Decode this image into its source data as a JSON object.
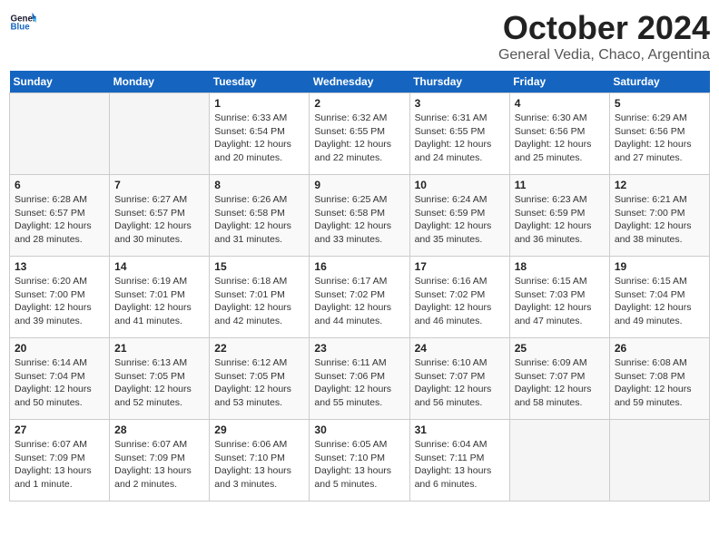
{
  "logo": {
    "line1": "General",
    "line2": "Blue"
  },
  "title": "October 2024",
  "subtitle": "General Vedia, Chaco, Argentina",
  "days_of_week": [
    "Sunday",
    "Monday",
    "Tuesday",
    "Wednesday",
    "Thursday",
    "Friday",
    "Saturday"
  ],
  "weeks": [
    [
      {
        "day": "",
        "info": ""
      },
      {
        "day": "",
        "info": ""
      },
      {
        "day": "1",
        "info": "Sunrise: 6:33 AM\nSunset: 6:54 PM\nDaylight: 12 hours\nand 20 minutes."
      },
      {
        "day": "2",
        "info": "Sunrise: 6:32 AM\nSunset: 6:55 PM\nDaylight: 12 hours\nand 22 minutes."
      },
      {
        "day": "3",
        "info": "Sunrise: 6:31 AM\nSunset: 6:55 PM\nDaylight: 12 hours\nand 24 minutes."
      },
      {
        "day": "4",
        "info": "Sunrise: 6:30 AM\nSunset: 6:56 PM\nDaylight: 12 hours\nand 25 minutes."
      },
      {
        "day": "5",
        "info": "Sunrise: 6:29 AM\nSunset: 6:56 PM\nDaylight: 12 hours\nand 27 minutes."
      }
    ],
    [
      {
        "day": "6",
        "info": "Sunrise: 6:28 AM\nSunset: 6:57 PM\nDaylight: 12 hours\nand 28 minutes."
      },
      {
        "day": "7",
        "info": "Sunrise: 6:27 AM\nSunset: 6:57 PM\nDaylight: 12 hours\nand 30 minutes."
      },
      {
        "day": "8",
        "info": "Sunrise: 6:26 AM\nSunset: 6:58 PM\nDaylight: 12 hours\nand 31 minutes."
      },
      {
        "day": "9",
        "info": "Sunrise: 6:25 AM\nSunset: 6:58 PM\nDaylight: 12 hours\nand 33 minutes."
      },
      {
        "day": "10",
        "info": "Sunrise: 6:24 AM\nSunset: 6:59 PM\nDaylight: 12 hours\nand 35 minutes."
      },
      {
        "day": "11",
        "info": "Sunrise: 6:23 AM\nSunset: 6:59 PM\nDaylight: 12 hours\nand 36 minutes."
      },
      {
        "day": "12",
        "info": "Sunrise: 6:21 AM\nSunset: 7:00 PM\nDaylight: 12 hours\nand 38 minutes."
      }
    ],
    [
      {
        "day": "13",
        "info": "Sunrise: 6:20 AM\nSunset: 7:00 PM\nDaylight: 12 hours\nand 39 minutes."
      },
      {
        "day": "14",
        "info": "Sunrise: 6:19 AM\nSunset: 7:01 PM\nDaylight: 12 hours\nand 41 minutes."
      },
      {
        "day": "15",
        "info": "Sunrise: 6:18 AM\nSunset: 7:01 PM\nDaylight: 12 hours\nand 42 minutes."
      },
      {
        "day": "16",
        "info": "Sunrise: 6:17 AM\nSunset: 7:02 PM\nDaylight: 12 hours\nand 44 minutes."
      },
      {
        "day": "17",
        "info": "Sunrise: 6:16 AM\nSunset: 7:02 PM\nDaylight: 12 hours\nand 46 minutes."
      },
      {
        "day": "18",
        "info": "Sunrise: 6:15 AM\nSunset: 7:03 PM\nDaylight: 12 hours\nand 47 minutes."
      },
      {
        "day": "19",
        "info": "Sunrise: 6:15 AM\nSunset: 7:04 PM\nDaylight: 12 hours\nand 49 minutes."
      }
    ],
    [
      {
        "day": "20",
        "info": "Sunrise: 6:14 AM\nSunset: 7:04 PM\nDaylight: 12 hours\nand 50 minutes."
      },
      {
        "day": "21",
        "info": "Sunrise: 6:13 AM\nSunset: 7:05 PM\nDaylight: 12 hours\nand 52 minutes."
      },
      {
        "day": "22",
        "info": "Sunrise: 6:12 AM\nSunset: 7:05 PM\nDaylight: 12 hours\nand 53 minutes."
      },
      {
        "day": "23",
        "info": "Sunrise: 6:11 AM\nSunset: 7:06 PM\nDaylight: 12 hours\nand 55 minutes."
      },
      {
        "day": "24",
        "info": "Sunrise: 6:10 AM\nSunset: 7:07 PM\nDaylight: 12 hours\nand 56 minutes."
      },
      {
        "day": "25",
        "info": "Sunrise: 6:09 AM\nSunset: 7:07 PM\nDaylight: 12 hours\nand 58 minutes."
      },
      {
        "day": "26",
        "info": "Sunrise: 6:08 AM\nSunset: 7:08 PM\nDaylight: 12 hours\nand 59 minutes."
      }
    ],
    [
      {
        "day": "27",
        "info": "Sunrise: 6:07 AM\nSunset: 7:09 PM\nDaylight: 13 hours\nand 1 minute."
      },
      {
        "day": "28",
        "info": "Sunrise: 6:07 AM\nSunset: 7:09 PM\nDaylight: 13 hours\nand 2 minutes."
      },
      {
        "day": "29",
        "info": "Sunrise: 6:06 AM\nSunset: 7:10 PM\nDaylight: 13 hours\nand 3 minutes."
      },
      {
        "day": "30",
        "info": "Sunrise: 6:05 AM\nSunset: 7:10 PM\nDaylight: 13 hours\nand 5 minutes."
      },
      {
        "day": "31",
        "info": "Sunrise: 6:04 AM\nSunset: 7:11 PM\nDaylight: 13 hours\nand 6 minutes."
      },
      {
        "day": "",
        "info": ""
      },
      {
        "day": "",
        "info": ""
      }
    ]
  ]
}
